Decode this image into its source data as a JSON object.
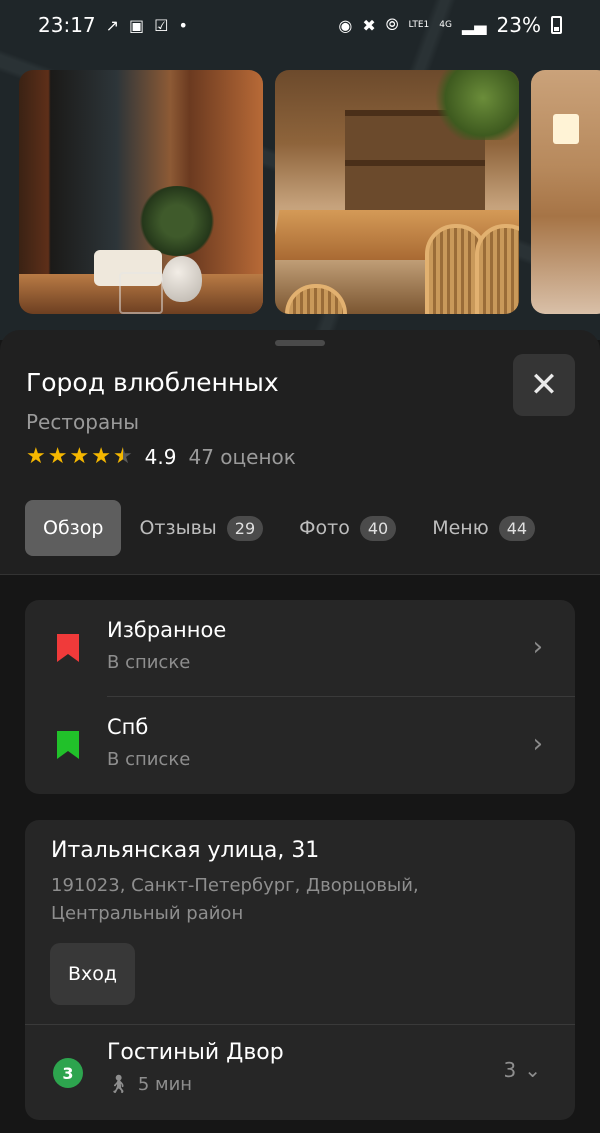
{
  "status_bar": {
    "time": "23:17",
    "network": "4G",
    "lte": "LTE1",
    "battery": "23%"
  },
  "place": {
    "title": "Город влюбленных",
    "category": "Рестораны",
    "rating": "4.9",
    "rating_stars": 4.9,
    "rating_count": "47 оценок"
  },
  "tabs": [
    {
      "label": "Обзор",
      "active": true
    },
    {
      "label": "Отзывы",
      "count": "29"
    },
    {
      "label": "Фото",
      "count": "40"
    },
    {
      "label": "Меню",
      "count": "44"
    }
  ],
  "lists": [
    {
      "name": "Избранное",
      "status": "В списке",
      "color": "#f03a3a"
    },
    {
      "name": "Спб",
      "status": "В списке",
      "color": "#21c12a"
    }
  ],
  "address": {
    "street": "Итальянская улица, 31",
    "details": "191023, Санкт-Петербург, Дворцовый, Центральный район",
    "entrance_label": "Вход"
  },
  "metro": {
    "line": "3",
    "line_color": "#2da44e",
    "station": "Гостиный Двор",
    "walk_time": "5 мин",
    "more_count": "3"
  }
}
